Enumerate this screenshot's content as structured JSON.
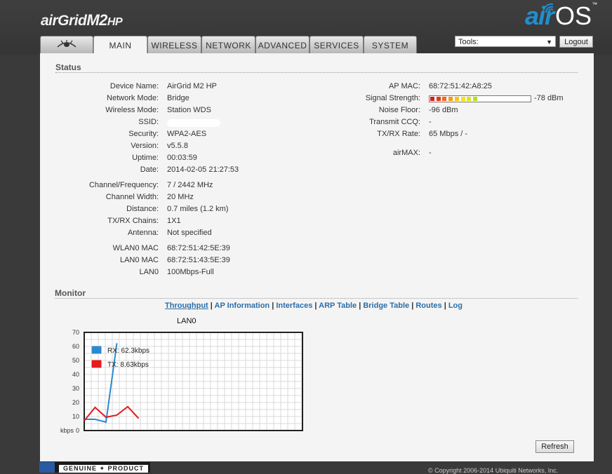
{
  "header": {
    "brand_prefix": "airGrid",
    "brand_model": "M2",
    "brand_suffix": "HP",
    "airos_air": "air",
    "airos_os": "OS",
    "airos_tm": "™"
  },
  "tabs": [
    {
      "label": "MAIN",
      "active": true
    },
    {
      "label": "WIRELESS"
    },
    {
      "label": "NETWORK"
    },
    {
      "label": "ADVANCED"
    },
    {
      "label": "SERVICES"
    },
    {
      "label": "SYSTEM"
    }
  ],
  "tools": {
    "label": "Tools:"
  },
  "logout_label": "Logout",
  "status": {
    "title": "Status",
    "left": [
      {
        "label": "Device Name:",
        "value": "AirGrid M2 HP"
      },
      {
        "label": "Network Mode:",
        "value": "Bridge"
      },
      {
        "label": "Wireless Mode:",
        "value": "Station WDS"
      },
      {
        "label": "SSID:",
        "value": ""
      },
      {
        "label": "Security:",
        "value": "WPA2-AES"
      },
      {
        "label": "Version:",
        "value": "v5.5.8"
      },
      {
        "label": "Uptime:",
        "value": "00:03:59"
      },
      {
        "label": "Date:",
        "value": "2014-02-05 21:27:53"
      },
      {
        "label": "Channel/Frequency:",
        "value": "7 / 2442 MHz"
      },
      {
        "label": "Channel Width:",
        "value": "20 MHz"
      },
      {
        "label": "Distance:",
        "value": "0.7 miles (1.2 km)"
      },
      {
        "label": "TX/RX Chains:",
        "value": "1X1"
      },
      {
        "label": "Antenna:",
        "value": "Not specified"
      },
      {
        "label": "WLAN0 MAC",
        "value": "68:72:51:42:5E:39"
      },
      {
        "label": "LAN0 MAC",
        "value": "68:72:51:43:5E:39"
      },
      {
        "label": "LAN0",
        "value": "100Mbps-Full"
      }
    ],
    "right": [
      {
        "label": "AP MAC:",
        "value": "68:72:51:42:A8:25"
      },
      {
        "label": "Signal Strength:",
        "value": "-78 dBm"
      },
      {
        "label": "Noise Floor:",
        "value": "-96 dBm"
      },
      {
        "label": "Transmit CCQ:",
        "value": "-"
      },
      {
        "label": "TX/RX Rate:",
        "value": "65 Mbps / -"
      },
      {
        "label": "airMAX:",
        "value": "-"
      }
    ],
    "signal_level": 0.6
  },
  "monitor": {
    "title": "Monitor",
    "links": [
      {
        "label": "Throughput",
        "active": true
      },
      {
        "label": "AP Information"
      },
      {
        "label": "Interfaces"
      },
      {
        "label": "ARP Table"
      },
      {
        "label": "Bridge Table"
      },
      {
        "label": "Routes"
      },
      {
        "label": "Log"
      }
    ],
    "refresh_label": "Refresh"
  },
  "chart_data": {
    "type": "line",
    "title": "LAN0",
    "ylabel": "kbps",
    "ylim": [
      0,
      70
    ],
    "yticks": [
      "0",
      "10",
      "20",
      "30",
      "40",
      "50",
      "60",
      "70"
    ],
    "grid": true,
    "legend": "top-left",
    "x": [
      0,
      1,
      2,
      3,
      4,
      5
    ],
    "series": [
      {
        "name": "RX: 62.3kbps",
        "color": "#2a8ad0",
        "values": [
          8,
          8,
          6,
          62.3,
          null,
          null
        ]
      },
      {
        "name": "TX: 8.63kbps",
        "color": "#e31b1b",
        "values": [
          7,
          16.5,
          9.5,
          11,
          17,
          8.63
        ]
      }
    ]
  },
  "footer": {
    "badge_text": "GENUINE ✦ PRODUCT",
    "copyright": "© Copyright 2006-2014 Ubiquiti Networks, Inc."
  }
}
